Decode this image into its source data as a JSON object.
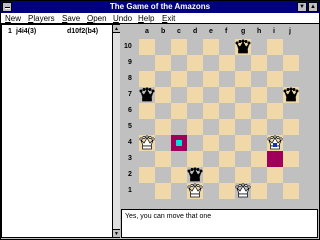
{
  "window": {
    "title": "The Game of the Amazons"
  },
  "menu": {
    "items": [
      "New",
      "Players",
      "Save",
      "Open",
      "Undo",
      "Help",
      "Exit"
    ]
  },
  "moves": {
    "rows": [
      {
        "num": "1",
        "white": "j4i4(3)",
        "black": "d10f2(b4)"
      }
    ]
  },
  "board": {
    "files": [
      "a",
      "b",
      "c",
      "d",
      "e",
      "f",
      "g",
      "h",
      "i",
      "j"
    ],
    "ranks": [
      "10",
      "9",
      "8",
      "7",
      "6",
      "5",
      "4",
      "3",
      "2",
      "1"
    ],
    "pieces": [
      {
        "square": "g10",
        "color": "black"
      },
      {
        "square": "a7",
        "color": "black"
      },
      {
        "square": "j7",
        "color": "black"
      },
      {
        "square": "d2",
        "color": "black"
      },
      {
        "square": "a4",
        "color": "white"
      },
      {
        "square": "i4",
        "color": "white",
        "selected": true
      },
      {
        "square": "d1",
        "color": "white"
      },
      {
        "square": "g1",
        "color": "white"
      }
    ],
    "arrows": [
      "c4",
      "i3"
    ],
    "marker_square": "c4",
    "colors": {
      "light": "#f0d8a8",
      "dark": "#c0c0c0",
      "arrow": "#a0005a",
      "marker": "#00e0e0"
    }
  },
  "status": {
    "message": "Yes, you can move that one"
  }
}
